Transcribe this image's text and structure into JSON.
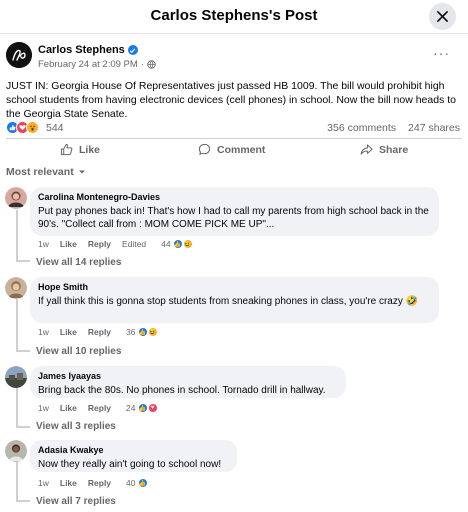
{
  "header": {
    "title": "Carlos Stephens's Post"
  },
  "post": {
    "author": "Carlos Stephens",
    "date": "February 24 at 2:09 PM",
    "separator": "·",
    "text": "JUST IN: Georgia House Of Representatives just passed HB 1009. The bill would prohibit high school students from having electronic devices (cell phones) in school. Now the bill now heads to the Georgia State Senate.",
    "reaction_count": "544",
    "comments_count": "356 comments",
    "shares_count": "247 shares",
    "reaction_types": [
      "like",
      "love",
      "wow"
    ]
  },
  "actions": {
    "like": "Like",
    "comment": "Comment",
    "share": "Share"
  },
  "sort": {
    "label": "Most relevant"
  },
  "comments": [
    {
      "name": "Carolina Montenegro-Davies",
      "text": "Put pay phones back in! That's how I had to call my parents from high school back in the 90's. \"Collect call from : MOM COME PICK ME UP\"...",
      "time": "1w",
      "like": "Like",
      "reply": "Reply",
      "edited": "Edited",
      "reactions": "44",
      "reaction_types": [
        "like",
        "haha"
      ],
      "view_replies": "View all 14 replies"
    },
    {
      "name": "Hope Smith",
      "text": "If yall think this is gonna stop students from sneaking phones in class, you're crazy 🤣",
      "time": "1w",
      "like": "Like",
      "reply": "Reply",
      "reactions": "36",
      "reaction_types": [
        "like",
        "haha"
      ],
      "view_replies": "View all 10 replies"
    },
    {
      "name": "James Iyaayas",
      "text": "Bring back the 80s. No phones in school. Tornado drill in hallway.",
      "time": "1w",
      "like": "Like",
      "reply": "Reply",
      "reactions": "24",
      "reaction_types": [
        "like",
        "love"
      ],
      "view_replies": "View all 3 replies"
    },
    {
      "name": "Adasia Kwakye",
      "text": "Now they really ain't going to school now!",
      "time": "1w",
      "like": "Like",
      "reply": "Reply",
      "reactions": "40",
      "reaction_types": [
        "like"
      ],
      "view_replies": "View all 7 replies"
    }
  ],
  "colors": {
    "accent": "#1877f2",
    "love": "#f33e58",
    "haha": "#f7b125",
    "bubble": "#f0f2f5",
    "muted": "#65676b"
  }
}
